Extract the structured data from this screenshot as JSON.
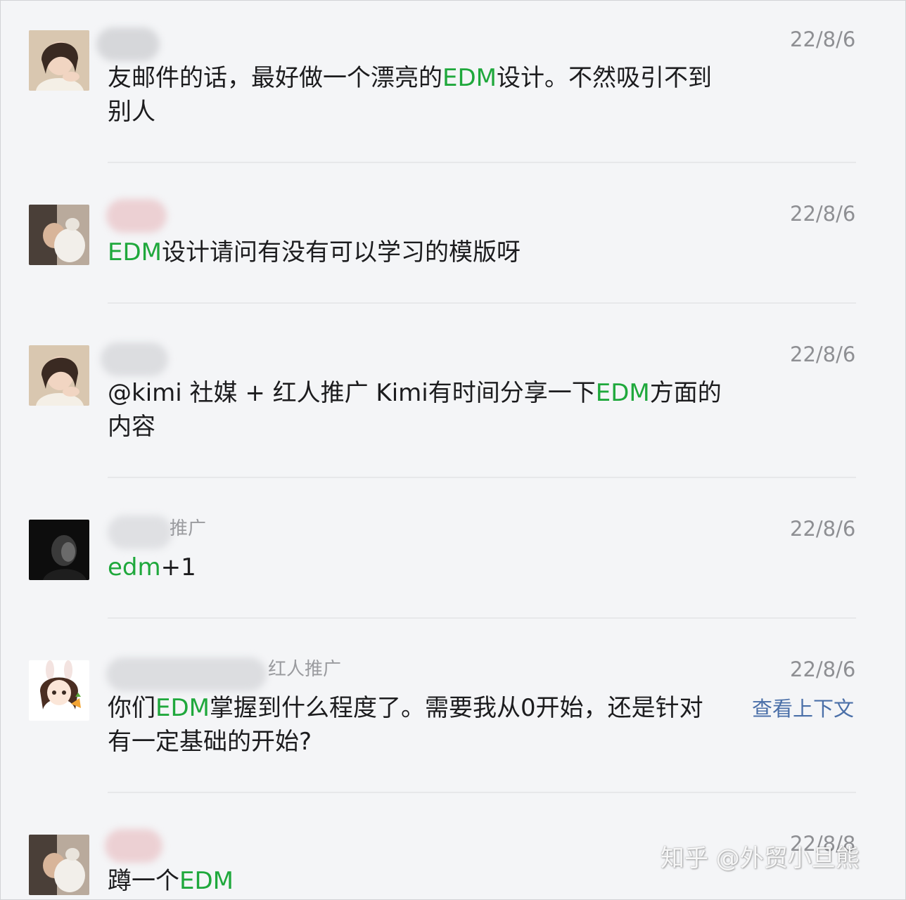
{
  "comments": [
    {
      "date": "22/8/6",
      "text_parts": [
        "友邮件的话，最好做一个漂亮的",
        "EDM",
        "设计。不然吸引不到别人"
      ],
      "name_suffix": "",
      "avatar": "girl-photo-avatar"
    },
    {
      "date": "22/8/6",
      "text_parts": [
        "",
        "EDM",
        "设计请问有没有可以学习的模版呀"
      ],
      "name_suffix": "",
      "avatar": "person-with-cat-avatar"
    },
    {
      "date": "22/8/6",
      "text_parts": [
        "@kimi 社媒 + 红人推广 Kimi有时间分享一下",
        "EDM",
        "方面的内容"
      ],
      "name_suffix": "",
      "avatar": "girl-photo-avatar"
    },
    {
      "date": "22/8/6",
      "text_parts": [
        "",
        "edm",
        "+1"
      ],
      "name_suffix": "推广",
      "avatar": "dark-portrait-avatar"
    },
    {
      "date": "22/8/6",
      "text_parts": [
        "你们",
        "EDM",
        "掌握到什么程度了。需要我从0开始，还是针对有一定基础的开始?"
      ],
      "name_suffix": "红人推广",
      "context_link": "查看上下文",
      "avatar": "cartoon-bunny-girl-avatar"
    },
    {
      "date": "22/8/8",
      "text_parts": [
        "蹲一个",
        "EDM",
        ""
      ],
      "name_suffix": "",
      "avatar": "person-with-cat-avatar"
    }
  ],
  "watermark": "知乎 @外贸小旦熊",
  "colors": {
    "highlight": "#1fa83c",
    "link": "#4a6fa8",
    "date": "#8e8f93",
    "background": "#f4f5f7"
  }
}
